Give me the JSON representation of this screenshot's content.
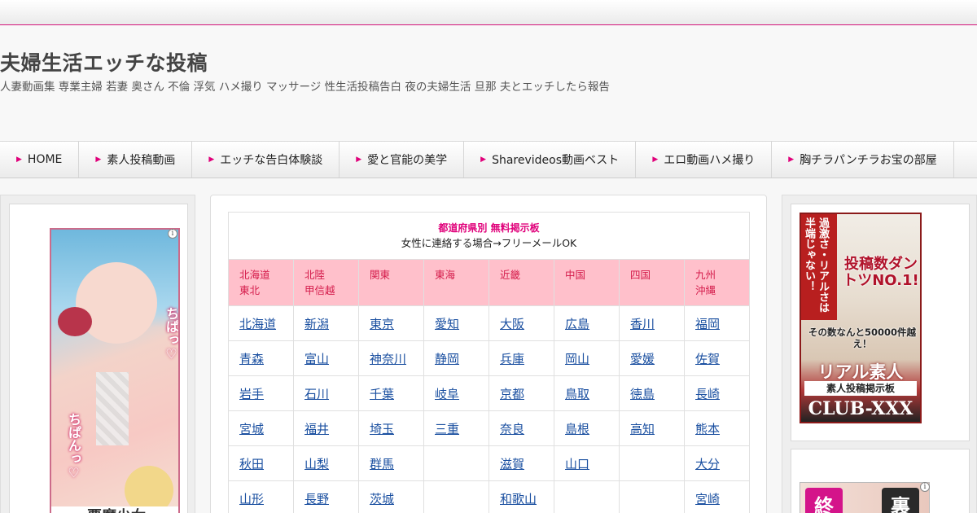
{
  "site": {
    "title": "夫婦生活エッチな投稿",
    "description": "人妻動画集 専業主婦 若妻 奥さん 不倫 浮気 ハメ撮り マッサージ 性生活投稿告白 夜の夫婦生活 旦那 夫とエッチしたら報告"
  },
  "nav": [
    {
      "label": "HOME"
    },
    {
      "label": "素人投稿動画"
    },
    {
      "label": "エッチな告白体験談"
    },
    {
      "label": "愛と官能の美学"
    },
    {
      "label": "Sharevideos動画ベスト"
    },
    {
      "label": "エロ動画ハメ撮り"
    },
    {
      "label": "胸チラパンチラお宝の部屋"
    }
  ],
  "board": {
    "title": "都道府県別 無料掲示板",
    "subtitle": "女性に連絡する場合→フリーメールOK",
    "regions": [
      "北海道\n東北",
      "北陸\n甲信越",
      "関東",
      "東海",
      "近畿",
      "中国",
      "四国",
      "九州\n沖縄"
    ],
    "rows": [
      [
        "北海道",
        "新潟",
        "東京",
        "愛知",
        "大阪",
        "広島",
        "香川",
        "福岡"
      ],
      [
        "青森",
        "富山",
        "神奈川",
        "静岡",
        "兵庫",
        "岡山",
        "愛媛",
        "佐賀"
      ],
      [
        "岩手",
        "石川",
        "千葉",
        "岐阜",
        "京都",
        "鳥取",
        "徳島",
        "長崎"
      ],
      [
        "宮城",
        "福井",
        "埼玉",
        "三重",
        "奈良",
        "島根",
        "高知",
        "熊本"
      ],
      [
        "秋田",
        "山梨",
        "群馬",
        "",
        "滋賀",
        "山口",
        "",
        "大分"
      ],
      [
        "山形",
        "長野",
        "茨城",
        "",
        "和歌山",
        "",
        "",
        "宮崎"
      ]
    ]
  },
  "ads": {
    "left": {
      "text1": "ちぱっ♡",
      "text2": "ちぱんっ♡",
      "bottom": "悪魔少女"
    },
    "right": {
      "vtext1": "過激さ・リアルさは",
      "vtext2": "半端じゃない！",
      "headline": "投稿数ダントツNO.1!",
      "sub": "その数なんと50000件越え！",
      "brand": "リアル素人",
      "board": "素人投稿掲示板",
      "club": "CLUB-XXX"
    },
    "right2": {
      "k1": "終",
      "k2": "裏"
    }
  },
  "colors": {
    "accent": "#e0007a",
    "region_bg": "#ffc0cb",
    "link": "#1a4fa0"
  }
}
